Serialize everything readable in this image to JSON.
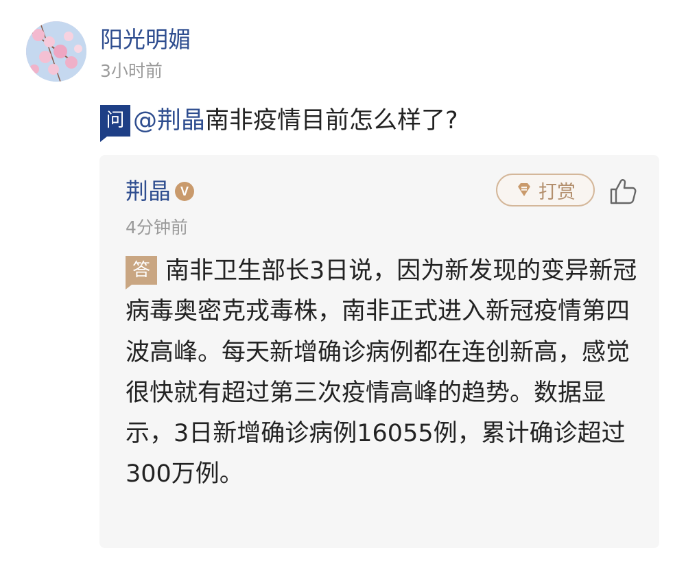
{
  "post": {
    "author": "阳光明媚",
    "time": "3小时前",
    "avatar_icon": "cherry-blossom-avatar"
  },
  "question": {
    "badge": "问",
    "mention": "@荆晶",
    "text": "南非疫情目前怎么样了?"
  },
  "answer": {
    "author": "荆晶",
    "verified_badge": "V",
    "tip_label": "打赏",
    "time": "4分钟前",
    "badge": "答",
    "body": "南非卫生部长3日说，因为新发现的变异新冠病毒奥密克戎毒株，南非正式进入新冠疫情第四波高峰。每天新增确诊病例都在连创新高，感觉很快就有超过第三次疫情高峰的趋势。数据显示，3日新增确诊病例16055例，累计确诊超过300万例。"
  },
  "colors": {
    "link_blue": "#2e4d8f",
    "question_badge": "#1e3f86",
    "answer_badge": "#c9a682",
    "card_bg": "#f6f6f6",
    "muted_text": "#9a9a9a"
  }
}
